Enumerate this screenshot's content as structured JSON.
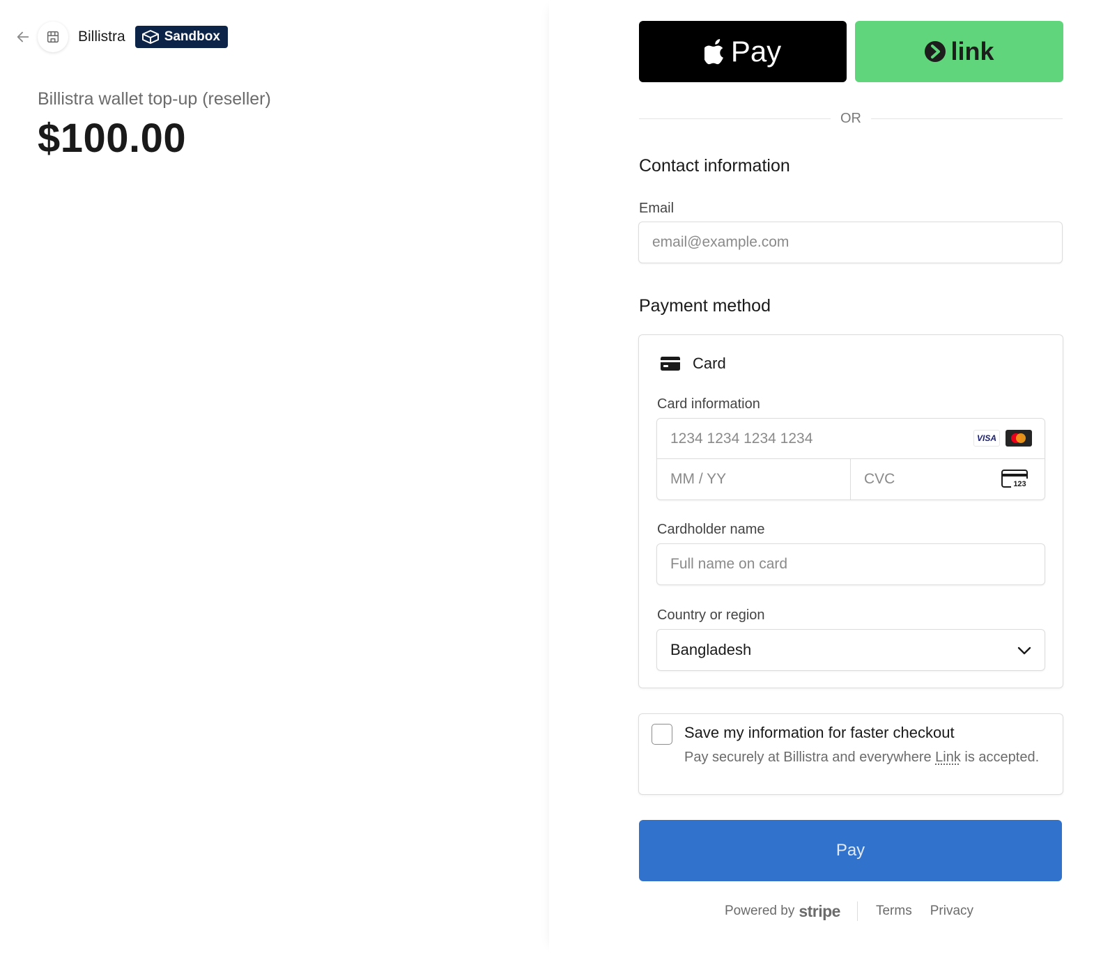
{
  "header": {
    "merchant_name": "Billistra",
    "badge": "Sandbox",
    "back_icon": "arrow-left-icon",
    "store_icon": "storefront-icon"
  },
  "summary": {
    "product_name": "Billistra wallet top-up (reseller)",
    "amount": "$100.00"
  },
  "express": {
    "apple_pay_label": "Pay",
    "link_label": "link",
    "divider": "OR"
  },
  "contact": {
    "title": "Contact information",
    "email_label": "Email",
    "email_placeholder": "email@example.com"
  },
  "payment": {
    "title": "Payment method",
    "tab_label": "Card",
    "card_info_label": "Card information",
    "card_number_placeholder": "1234 1234 1234 1234",
    "visa_text": "VISA",
    "expiry_placeholder": "MM / YY",
    "cvc_placeholder": "CVC",
    "cvc_icon_text": "123",
    "cardholder_label": "Cardholder name",
    "cardholder_placeholder": "Full name on card",
    "country_label": "Country or region",
    "country_value": "Bangladesh"
  },
  "save_info": {
    "title": "Save my information for faster checkout",
    "desc_prefix": "Pay securely at Billistra and everywhere ",
    "desc_link": "Link",
    "desc_suffix": " is accepted."
  },
  "pay_button": {
    "label": "Pay"
  },
  "footer": {
    "powered_by": "Powered by",
    "brand": "stripe",
    "terms": "Terms",
    "privacy": "Privacy"
  },
  "colors": {
    "link_green": "#61d57b",
    "pay_blue": "#3173cc",
    "sandbox_navy": "#0b2447"
  }
}
